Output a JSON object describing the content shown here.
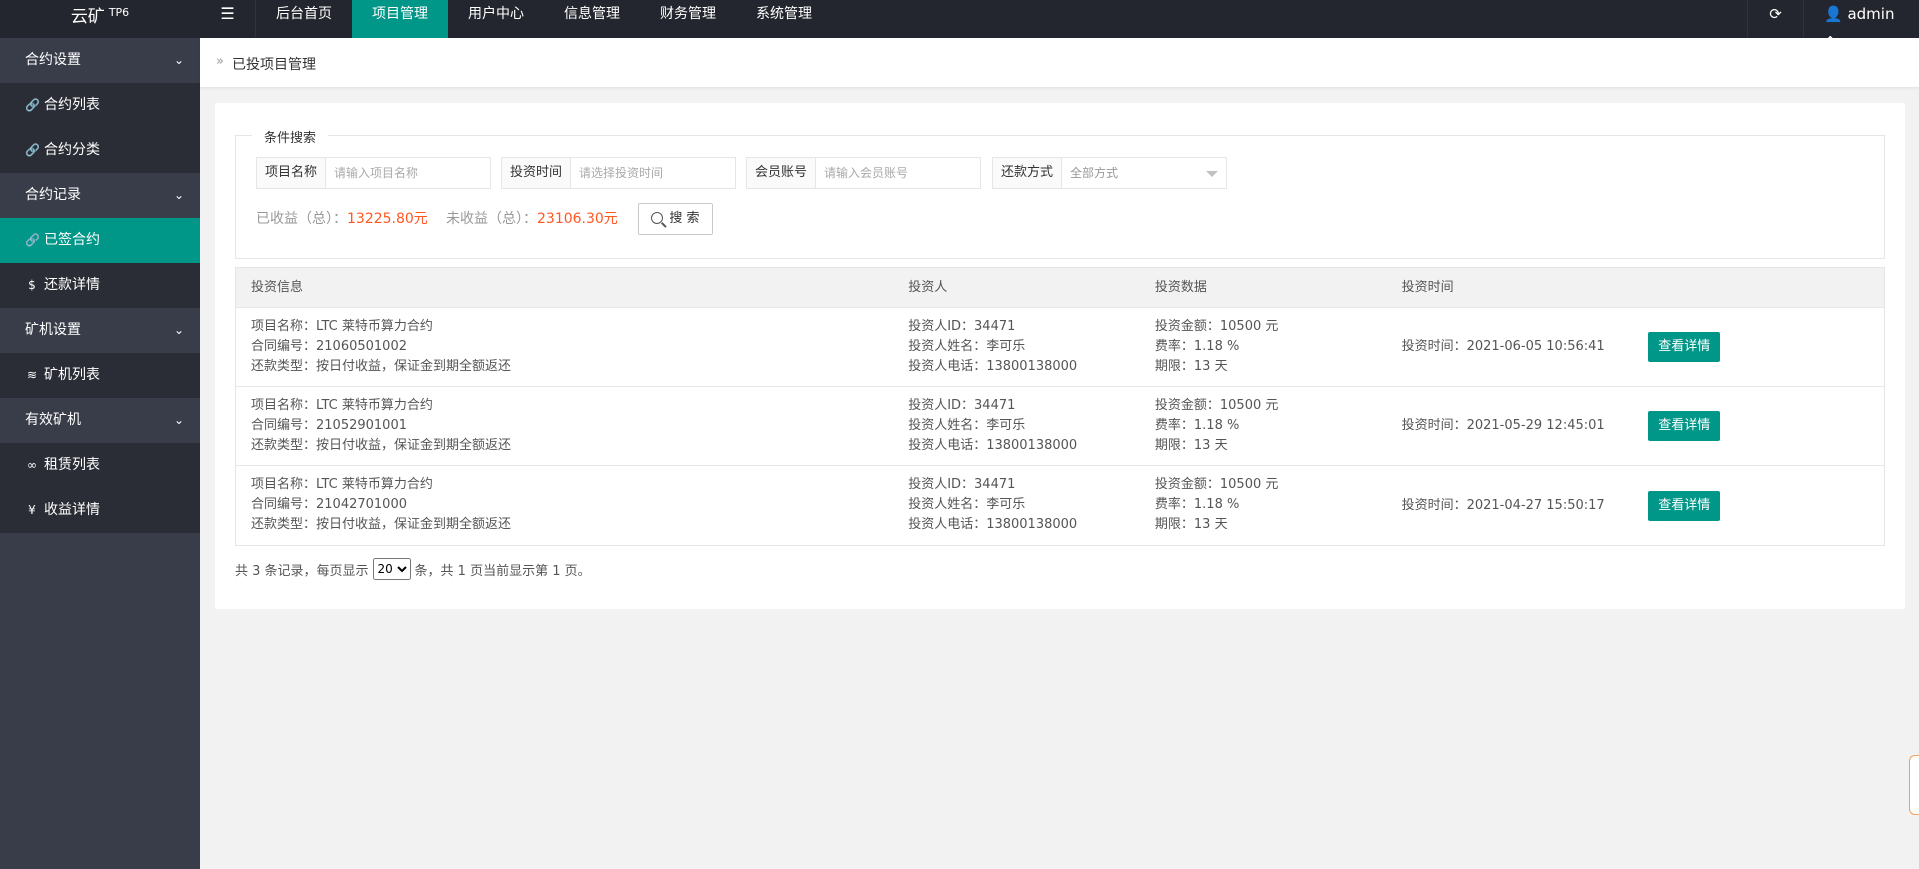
{
  "app": {
    "logo": "云矿",
    "logo_sup": "TP6"
  },
  "topnav": {
    "menu_toggle_icon": "menu-fold-icon",
    "items": [
      {
        "label": "后台首页",
        "active": false
      },
      {
        "label": "项目管理",
        "active": true
      },
      {
        "label": "用户中心",
        "active": false
      },
      {
        "label": "信息管理",
        "active": false
      },
      {
        "label": "财务管理",
        "active": false
      },
      {
        "label": "系统管理",
        "active": false
      }
    ],
    "refresh_icon": "refresh-icon",
    "user": "admin"
  },
  "sidebar": {
    "groups": [
      {
        "label": "合约设置",
        "items": [
          {
            "label": "合约列表",
            "icon": "link-icon",
            "glyph": "🔗"
          },
          {
            "label": "合约分类",
            "icon": "link-icon",
            "glyph": "🔗"
          }
        ]
      },
      {
        "label": "合约记录",
        "items": [
          {
            "label": "已签合约",
            "icon": "link-icon",
            "glyph": "🔗",
            "active": true
          },
          {
            "label": "还款详情",
            "icon": "dollar-icon",
            "glyph": "$"
          }
        ]
      },
      {
        "label": "矿机设置",
        "items": [
          {
            "label": "矿机列表",
            "icon": "layers-icon",
            "glyph": "≋"
          }
        ]
      },
      {
        "label": "有效矿机",
        "items": [
          {
            "label": "租赁列表",
            "icon": "infinity-icon",
            "glyph": "∞"
          },
          {
            "label": "收益详情",
            "icon": "yen-icon",
            "glyph": "¥"
          }
        ]
      }
    ]
  },
  "breadcrumb": "已投项目管理",
  "search": {
    "legend": "条件搜索",
    "fields": [
      {
        "label": "项目名称",
        "placeholder": "请输入项目名称"
      },
      {
        "label": "投资时间",
        "placeholder": "请选择投资时间"
      },
      {
        "label": "会员账号",
        "placeholder": "请输入会员账号"
      },
      {
        "label": "还款方式",
        "value": "全部方式"
      }
    ],
    "earned_label": "已收益（总）：",
    "earned_value": "13225.80元",
    "unearned_label": "未收益（总）：",
    "unearned_value": "23106.30元",
    "button": "搜 索"
  },
  "table": {
    "headers": [
      "投资信息",
      "投资人",
      "投资数据",
      "投资时间",
      ""
    ],
    "rows": [
      {
        "name": "项目名称：LTC 莱特币算力合约",
        "contract": "合同编号：21060501002",
        "repay": "还款类型：按日付收益，保证金到期全额返还",
        "investor_id": "投资人ID：34471",
        "investor_name": "投资人姓名：李可乐",
        "investor_phone": "投资人电话：13800138000",
        "amount": "投资金额：10500 元",
        "rate": "费率：1.18 %",
        "term": "期限：13 天",
        "time": "投资时间：2021-06-05 10:56:41",
        "action": "查看详情"
      },
      {
        "name": "项目名称：LTC 莱特币算力合约",
        "contract": "合同编号：21052901001",
        "repay": "还款类型：按日付收益，保证金到期全额返还",
        "investor_id": "投资人ID：34471",
        "investor_name": "投资人姓名：李可乐",
        "investor_phone": "投资人电话：13800138000",
        "amount": "投资金额：10500 元",
        "rate": "费率：1.18 %",
        "term": "期限：13 天",
        "time": "投资时间：2021-05-29 12:45:01",
        "action": "查看详情"
      },
      {
        "name": "项目名称：LTC 莱特币算力合约",
        "contract": "合同编号：21042701000",
        "repay": "还款类型：按日付收益，保证金到期全额返还",
        "investor_id": "投资人ID：34471",
        "investor_name": "投资人姓名：李可乐",
        "investor_phone": "投资人电话：13800138000",
        "amount": "投资金额：10500 元",
        "rate": "费率：1.18 %",
        "term": "期限：13 天",
        "time": "投资时间：2021-04-27 15:50:17",
        "action": "查看详情"
      }
    ]
  },
  "pager": {
    "prefix": "共 3 条记录，每页显示",
    "per_page": "20",
    "suffix": "条，共 1 页当前显示第 1 页。"
  },
  "colors": {
    "accent": "#009688",
    "topbar": "#23262e",
    "sidebar": "#393d49",
    "highlight": "#ff5722"
  }
}
